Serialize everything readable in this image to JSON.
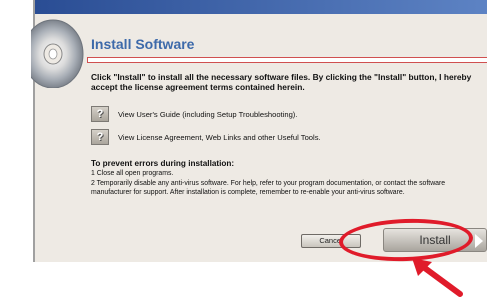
{
  "window": {
    "title": "Install Software"
  },
  "intro_text": "Click \"Install\" to install all the necessary software files.  By clicking the \"Install\" button, I hereby accept the license agreement terms contained herein.",
  "links": [
    {
      "icon": "question-icon",
      "icon_text": "?",
      "label": "View User's Guide (including Setup Troubleshooting)."
    },
    {
      "icon": "question-icon",
      "icon_text": "?",
      "label": "View License Agreement, Web Links and other Useful Tools."
    }
  ],
  "warning": {
    "heading": "To prevent errors during installation:",
    "step1": "1 Close all open programs.",
    "step2": "2 Temporarily disable any anti-virus software.  For help, refer to your program documentation, or contact the software manufacturer for support.  After installation is complete, remember to re-enable your anti-virus software."
  },
  "buttons": {
    "cancel": "Cancel",
    "install": "Install"
  },
  "colors": {
    "accent": "#3d6aaa",
    "highlight": "#e01b2a"
  }
}
